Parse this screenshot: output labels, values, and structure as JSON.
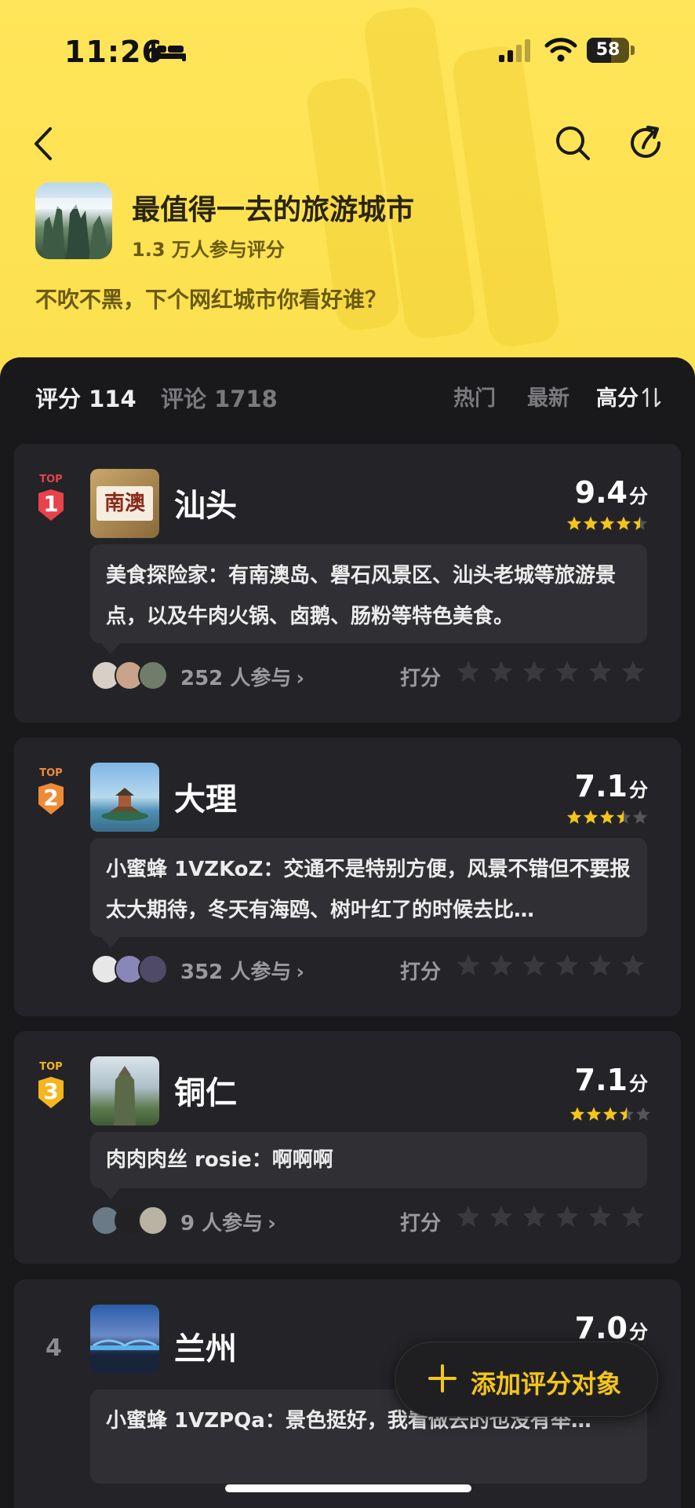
{
  "status_bar": {
    "time": "11:26",
    "battery": "58",
    "battery_level": 0.58
  },
  "topic": {
    "title": "最值得一去的旅游城市",
    "participants": "1.3 万人参与评分",
    "description": "不吹不黑，下个网红城市你看好谁？"
  },
  "tabs": {
    "rating": "评分 114",
    "comments": "评论 1718"
  },
  "sort": {
    "hot": "热门",
    "new": "最新",
    "high": "高分"
  },
  "rank_badge": {
    "top_text": "TOP"
  },
  "cities": [
    {
      "rank": "1",
      "name": "汕头",
      "score": "9.4",
      "score_unit": "分",
      "stars": 4.5,
      "comment": "美食探险家：有南澳岛、礐石风景区、汕头老城等旅游景点，以及牛肉火锅、卤鹅、肠粉等特色美食。",
      "participants": "252 人参与",
      "rate_label": "打分",
      "badge_color": "#E8424A",
      "thumb_text": "南澳"
    },
    {
      "rank": "2",
      "name": "大理",
      "score": "7.1",
      "score_unit": "分",
      "stars": 3.5,
      "comment": "小蜜蜂 1VZKoZ：交通不是特别方便，风景不错但不要报太大期待，冬天有海鸥、树叶红了的时候去比…",
      "participants": "352 人参与",
      "rate_label": "打分",
      "badge_color": "#F08A36"
    },
    {
      "rank": "3",
      "name": "铜仁",
      "score": "7.1",
      "score_unit": "分",
      "stars": 3.5,
      "comment": "肉肉肉丝 rosie：啊啊啊",
      "participants": "9 人参与",
      "rate_label": "打分",
      "badge_color": "#F5B51E"
    },
    {
      "rank": "4",
      "name": "兰州",
      "score": "7.0",
      "score_unit": "分",
      "comment": "小蜜蜂 1VZPQa：景色挺好，我看做去的也没有举…"
    }
  ],
  "fab": {
    "label": "添加评分对象"
  },
  "icons": {
    "back": "chevron-left-icon",
    "search": "search-icon",
    "share": "share-icon",
    "sort": "sort-arrows-icon",
    "star": "star-icon",
    "plus": "plus-icon",
    "chevron": "chevron-right-icon"
  },
  "colors": {
    "accent": "#F5C518",
    "header_bg": "#FCE04E",
    "panel_bg": "#19191C",
    "card_bg": "#242428"
  }
}
